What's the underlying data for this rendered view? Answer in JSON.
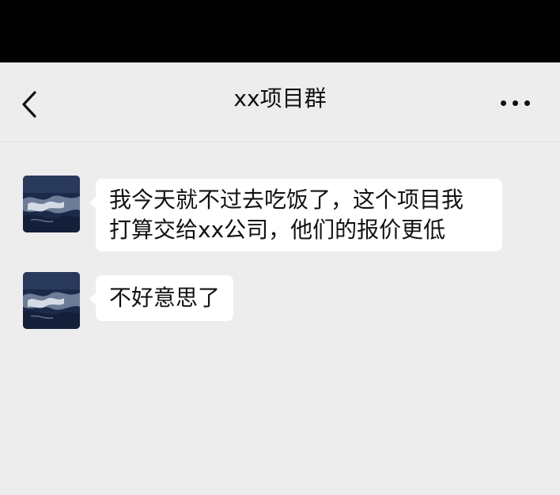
{
  "header": {
    "title": "xx项目群",
    "back_icon": "chevron-left-icon",
    "more_icon": "more-dots-icon"
  },
  "messages": [
    {
      "sender_avatar": "ocean-wave-avatar",
      "lines": [
        "我今天就不过去吃饭了，这个项目我",
        "打算交给xx公司，他们的报价更低"
      ]
    },
    {
      "sender_avatar": "ocean-wave-avatar",
      "lines": [
        "不好意思了"
      ]
    }
  ],
  "colors": {
    "status_bar": "#000000",
    "background": "#ededed",
    "bubble": "#ffffff",
    "text": "#111111"
  }
}
